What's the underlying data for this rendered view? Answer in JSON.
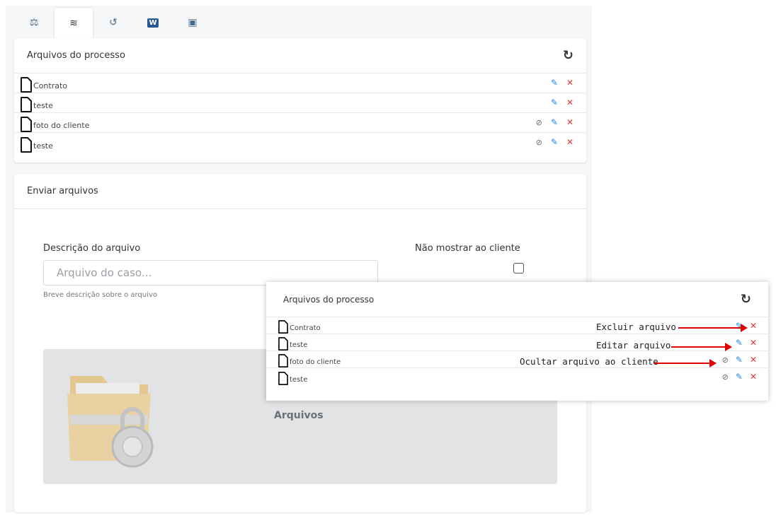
{
  "tabs": [
    {
      "icon": "balance-scale-icon",
      "glyph": "⚖"
    },
    {
      "icon": "layers-icon",
      "glyph": "≋"
    },
    {
      "icon": "history-icon",
      "glyph": "↺"
    },
    {
      "icon": "word-file-icon",
      "glyph": "W"
    },
    {
      "icon": "book-icon",
      "glyph": "▣"
    }
  ],
  "files_card": {
    "title": "Arquivos do processo",
    "refresh_glyph": "↻",
    "files": [
      {
        "name": "Contrato",
        "hidden_icon": false
      },
      {
        "name": "teste",
        "hidden_icon": false
      },
      {
        "name": "foto do cliente",
        "hidden_icon": true
      },
      {
        "name": "teste",
        "hidden_icon": true
      }
    ]
  },
  "upload_card": {
    "title": "Enviar arquivos",
    "description_label": "Descrição do arquivo",
    "description_placeholder": "Arquivo do caso...",
    "description_help": "Breve descrição sobre o arquivo",
    "hide_label": "Não mostrar ao cliente",
    "dropzone_label": "Arquivos"
  },
  "popup": {
    "title": "Arquivos do processo",
    "files": [
      {
        "name": "Contrato"
      },
      {
        "name": "teste"
      },
      {
        "name": "foto do cliente"
      },
      {
        "name": "teste"
      }
    ]
  },
  "annotations": {
    "delete": "Excluir arquivo",
    "edit": "Editar arquivo",
    "hide": "Ocultar arquivo ao cliente"
  },
  "glyphs": {
    "eye": "⊘",
    "edit": "✎",
    "delete": "✕"
  },
  "colors": {
    "edit": "#1e88e5",
    "delete": "#e53935",
    "arrow": "#e00000"
  }
}
